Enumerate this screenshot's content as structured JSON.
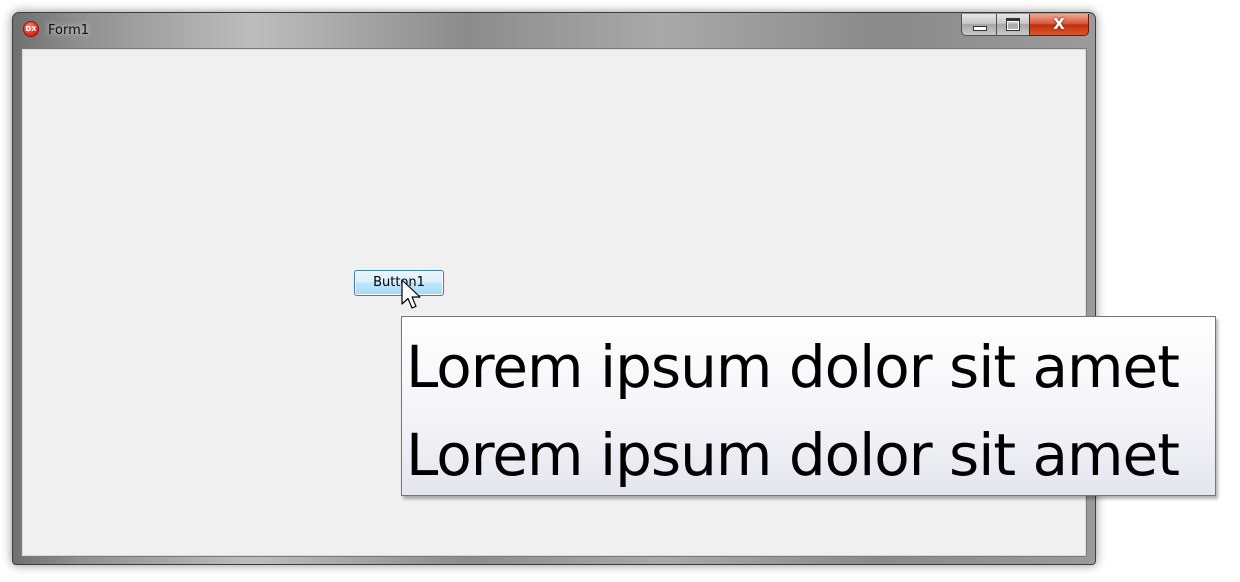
{
  "window": {
    "title": "Form1",
    "icon": "dx-app-icon",
    "icon_text": "DX",
    "caption_buttons": {
      "minimize": "minimize-icon",
      "maximize": "maximize-icon",
      "close": "close-icon",
      "close_glyph": "X"
    }
  },
  "form": {
    "button_label": "Button1"
  },
  "hint": {
    "lines": [
      "Lorem ipsum dolor sit amet",
      "Lorem ipsum dolor sit amet"
    ]
  },
  "colors": {
    "client_background": "#f0f0f0",
    "button_border": "#3c7fb1",
    "close_button": "#c7401b"
  }
}
